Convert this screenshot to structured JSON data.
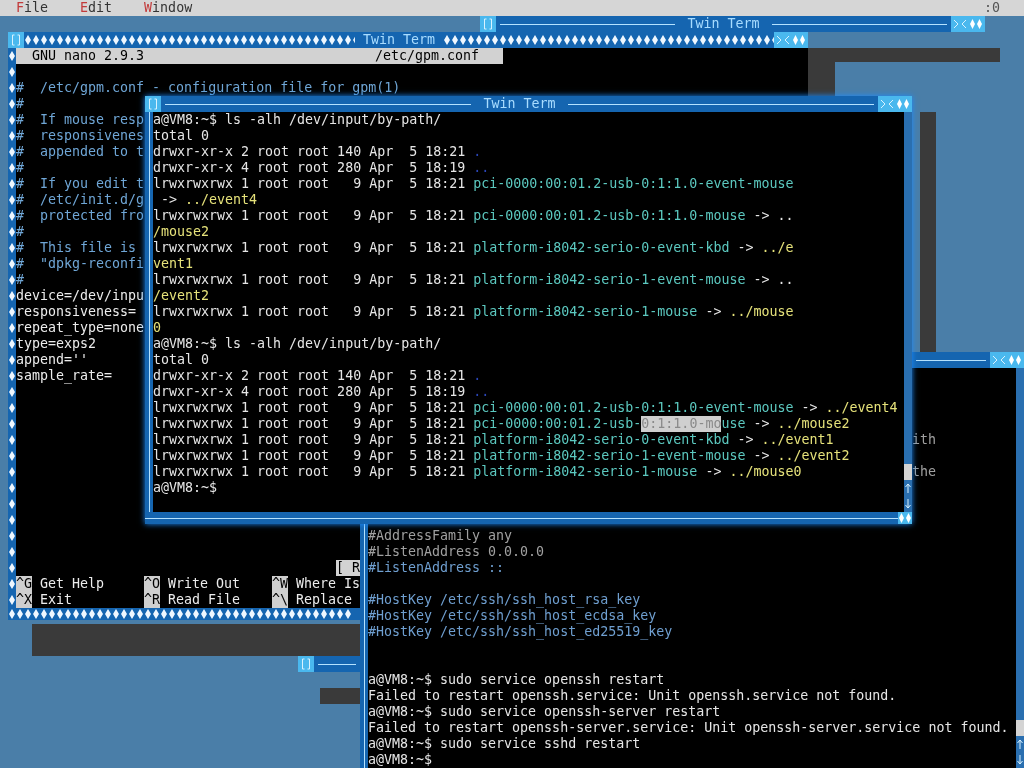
{
  "menu_bar": {
    "items": [
      {
        "label": "File"
      },
      {
        "label": "Edit"
      },
      {
        "label": "Window"
      }
    ],
    "display": ":0"
  },
  "back_window": {
    "title": "Twin Term",
    "diamond_border": false
  },
  "nano_window": {
    "title": "Twin Term",
    "diamond_border": true,
    "header": {
      "version": "GNU nano 2.9.3",
      "filename": "/etc/gpm.conf"
    },
    "lines": [
      {
        "kind": "comment",
        "text": "#  /etc/gpm.conf - configuration file for gpm(1)"
      },
      {
        "kind": "comment",
        "text": "#"
      },
      {
        "kind": "comment",
        "text": "#  If mouse resp"
      },
      {
        "kind": "comment",
        "text": "#  responsivenes"
      },
      {
        "kind": "comment",
        "text": "#  appended to t"
      },
      {
        "kind": "comment",
        "text": "#"
      },
      {
        "kind": "comment",
        "text": "#  If you edit t"
      },
      {
        "kind": "comment",
        "text": "#  /etc/init.d/g"
      },
      {
        "kind": "comment",
        "text": "#  protected fro"
      },
      {
        "kind": "comment",
        "text": "#"
      },
      {
        "kind": "comment",
        "text": "#  This file is"
      },
      {
        "kind": "comment",
        "text": "#  \"dpkg-reconfi"
      },
      {
        "kind": "comment",
        "text": "#"
      },
      {
        "kind": "setting",
        "text": "device=/dev/inpu"
      },
      {
        "kind": "setting",
        "text": "responsiveness="
      },
      {
        "kind": "setting",
        "text": "repeat_type=none"
      },
      {
        "kind": "setting",
        "text": "type=exps2"
      },
      {
        "kind": "setting",
        "text": "append=''"
      },
      {
        "kind": "setting",
        "text": "sample_rate="
      }
    ],
    "status": "[ R",
    "shortcuts": [
      {
        "key": "^G",
        "label": "Get Help"
      },
      {
        "key": "^O",
        "label": "Write Out"
      },
      {
        "key": "^W",
        "label": "Where Is"
      },
      {
        "key": "^X",
        "label": "Exit"
      },
      {
        "key": "^R",
        "label": "Read File"
      },
      {
        "key": "^\\",
        "label": "Replace"
      }
    ]
  },
  "ssh_window": {
    "diamond_border": false,
    "lines": [
      {
        "kind": "blank"
      },
      {
        "kind": "blank"
      },
      {
        "kind": "blank"
      },
      {
        "kind": "blank"
      },
      {
        "kind": "peek",
        "text": "ith"
      },
      {
        "kind": "blank"
      },
      {
        "kind": "peek",
        "text": "the"
      },
      {
        "kind": "blank"
      },
      {
        "kind": "blank"
      },
      {
        "kind": "blank"
      },
      {
        "kind": "muted",
        "text": "#AddressFamily any"
      },
      {
        "kind": "muted",
        "text": "#ListenAddress 0.0.0.0"
      },
      {
        "kind": "comment",
        "text": "#ListenAddress ::"
      },
      {
        "kind": "blank"
      },
      {
        "kind": "comment",
        "text": "#HostKey /etc/ssh/ssh_host_rsa_key"
      },
      {
        "kind": "comment",
        "text": "#HostKey /etc/ssh/ssh_host_ecdsa_key"
      },
      {
        "kind": "comment",
        "text": "#HostKey /etc/ssh/ssh_host_ed25519_key"
      },
      {
        "kind": "blank"
      },
      {
        "kind": "blank"
      },
      {
        "kind": "output",
        "text": "a@VM8:~$ sudo service openssh restart"
      },
      {
        "kind": "output",
        "text": "Failed to restart openssh.service: Unit openssh.service not found."
      },
      {
        "kind": "output",
        "text": "a@VM8:~$ sudo service openssh-server restart"
      },
      {
        "kind": "output",
        "text": "Failed to restart openssh-server.service: Unit openssh-server.service not found."
      },
      {
        "kind": "output",
        "text": "a@VM8:~$ sudo service sshd restart"
      },
      {
        "kind": "output",
        "text": "a@VM8:~$"
      }
    ]
  },
  "terminal_window": {
    "title": "Twin Term",
    "diamond_border": false,
    "lines": [
      [
        {
          "kind": "plain",
          "text": "a@VM8:~$ ls -alh /dev/input/by-path/"
        }
      ],
      [
        {
          "kind": "plain",
          "text": "total 0"
        }
      ],
      [
        {
          "kind": "plain",
          "text": "drwxr-xr-x 2 root root 140 Apr  5 18:21 "
        },
        {
          "kind": "dir",
          "text": "."
        }
      ],
      [
        {
          "kind": "plain",
          "text": "drwxr-xr-x 4 root root 280 Apr  5 18:19 "
        },
        {
          "kind": "dir",
          "text": ".."
        }
      ],
      [
        {
          "kind": "plain",
          "text": "lrwxrwxrwx 1 root root   9 Apr  5 18:21 "
        },
        {
          "kind": "link",
          "text": "pci-0000:00:01.2-usb-0:1:1.0-event-mouse"
        }
      ],
      [
        {
          "kind": "plain",
          "text": " -> "
        },
        {
          "kind": "target",
          "text": "../event4"
        }
      ],
      [
        {
          "kind": "plain",
          "text": "lrwxrwxrwx 1 root root   9 Apr  5 18:21 "
        },
        {
          "kind": "link",
          "text": "pci-0000:00:01.2-usb-0:1:1.0-mouse"
        },
        {
          "kind": "plain",
          "text": " -> .."
        }
      ],
      [
        {
          "kind": "target",
          "text": "/mouse2"
        }
      ],
      [
        {
          "kind": "plain",
          "text": "lrwxrwxrwx 1 root root   9 Apr  5 18:21 "
        },
        {
          "kind": "link",
          "text": "platform-i8042-serio-0-event-kbd"
        },
        {
          "kind": "plain",
          "text": " -> "
        },
        {
          "kind": "target",
          "text": "../e"
        }
      ],
      [
        {
          "kind": "target",
          "text": "vent1"
        }
      ],
      [
        {
          "kind": "plain",
          "text": "lrwxrwxrwx 1 root root   9 Apr  5 18:21 "
        },
        {
          "kind": "link",
          "text": "platform-i8042-serio-1-event-mouse"
        },
        {
          "kind": "plain",
          "text": " -> .."
        }
      ],
      [
        {
          "kind": "target",
          "text": "/event2"
        }
      ],
      [
        {
          "kind": "plain",
          "text": "lrwxrwxrwx 1 root root   9 Apr  5 18:21 "
        },
        {
          "kind": "link",
          "text": "platform-i8042-serio-1-mouse"
        },
        {
          "kind": "plain",
          "text": " -> "
        },
        {
          "kind": "target",
          "text": "../mouse"
        }
      ],
      [
        {
          "kind": "target",
          "text": "0"
        }
      ],
      [
        {
          "kind": "plain",
          "text": "a@VM8:~$ ls -alh /dev/input/by-path/"
        }
      ],
      [
        {
          "kind": "plain",
          "text": "total 0"
        }
      ],
      [
        {
          "kind": "plain",
          "text": "drwxr-xr-x 2 root root 140 Apr  5 18:21 "
        },
        {
          "kind": "dir",
          "text": "."
        }
      ],
      [
        {
          "kind": "plain",
          "text": "drwxr-xr-x 4 root root 280 Apr  5 18:19 "
        },
        {
          "kind": "dir",
          "text": ".."
        }
      ],
      [
        {
          "kind": "plain",
          "text": "lrwxrwxrwx 1 root root   9 Apr  5 18:21 "
        },
        {
          "kind": "link",
          "text": "pci-0000:00:01.2-usb-0:1:1.0-event-mouse"
        },
        {
          "kind": "plain",
          "text": " -> "
        },
        {
          "kind": "target",
          "text": "../event4"
        }
      ],
      [
        {
          "kind": "plain",
          "text": "lrwxrwxrwx 1 root root   9 Apr  5 18:21 "
        },
        {
          "kind": "link",
          "text": "pci-0000:00:01.2-usb-"
        },
        {
          "kind": "selection",
          "text": "0:1:1.0-mo"
        },
        {
          "kind": "link",
          "text": "use"
        },
        {
          "kind": "plain",
          "text": " -> "
        },
        {
          "kind": "target",
          "text": "../mouse2"
        }
      ],
      [
        {
          "kind": "plain",
          "text": "lrwxrwxrwx 1 root root   9 Apr  5 18:21 "
        },
        {
          "kind": "link",
          "text": "platform-i8042-serio-0-event-kbd"
        },
        {
          "kind": "plain",
          "text": " -> "
        },
        {
          "kind": "target",
          "text": "../event1"
        }
      ],
      [
        {
          "kind": "plain",
          "text": "lrwxrwxrwx 1 root root   9 Apr  5 18:21 "
        },
        {
          "kind": "link",
          "text": "platform-i8042-serio-1-event-mouse"
        },
        {
          "kind": "plain",
          "text": " -> "
        },
        {
          "kind": "target",
          "text": "../event2"
        }
      ],
      [
        {
          "kind": "plain",
          "text": "lrwxrwxrwx 1 root root   9 Apr  5 18:21 "
        },
        {
          "kind": "link",
          "text": "platform-i8042-serio-1-mouse"
        },
        {
          "kind": "plain",
          "text": " -> "
        },
        {
          "kind": "target",
          "text": "../mouse0"
        }
      ],
      [
        {
          "kind": "plain",
          "text": "a@VM8:~$"
        }
      ]
    ]
  }
}
